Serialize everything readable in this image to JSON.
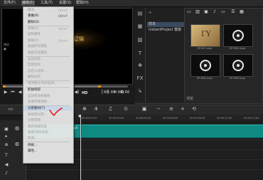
{
  "menubar": {
    "items": [
      "文件(F)",
      "编辑(E)",
      "工具(T)",
      "设置(S)",
      "帮助(H)"
    ]
  },
  "dropdown": {
    "items": [
      {
        "label": "撤消",
        "shortcut": "Ctrl+Z",
        "enabled": false
      },
      {
        "label": "重做(R)",
        "shortcut": "Ctrl+Y",
        "enabled": true
      },
      {
        "label": "删除(D)",
        "shortcut": "",
        "enabled": true
      },
      {
        "label": "复制(C)",
        "shortcut": "Ctrl+C",
        "enabled": false
      },
      {
        "label": "复制属性",
        "shortcut": "",
        "enabled": false
      },
      {
        "label": "粘贴(P)",
        "shortcut": "Ctrl+V",
        "enabled": false
      },
      {
        "label": "粘贴所有属性",
        "shortcut": "",
        "enabled": false
      },
      {
        "label": "粘贴可选属性...",
        "shortcut": "",
        "enabled": false
      },
      {
        "label": "运动追踪...",
        "shortcut": "",
        "enabled": false
      },
      {
        "label": "匹配动作",
        "shortcut": "",
        "enabled": false
      },
      {
        "label": "自定义动作...",
        "shortcut": "",
        "enabled": false
      },
      {
        "label": "删除动作",
        "shortcut": "",
        "enabled": false
      },
      {
        "label": "更改照片/色彩区间...",
        "shortcut": "",
        "enabled": false
      },
      {
        "label": "抓拍快照",
        "shortcut": "",
        "enabled": true
      },
      {
        "label": "自动摇动和缩放",
        "shortcut": "",
        "enabled": false
      },
      {
        "label": "多重修整视频...",
        "shortcut": "",
        "enabled": false
      },
      {
        "label": "分割素材(T)",
        "shortcut": "",
        "enabled": true
      },
      {
        "label": "按场景分割...",
        "shortcut": "",
        "enabled": false
      },
      {
        "label": "分割音频",
        "shortcut": "",
        "enabled": false
      },
      {
        "label": "重新链接检查",
        "shortcut": "",
        "enabled": false
      },
      {
        "label": "速度/时间流逝...",
        "shortcut": "",
        "enabled": false
      },
      {
        "label": "变速...",
        "shortcut": "",
        "enabled": false
      },
      {
        "label": "停帧...",
        "shortcut": "",
        "enabled": true
      },
      {
        "label": "属性...",
        "shortcut": "",
        "enabled": true
      }
    ],
    "highlighted_index": 16
  },
  "preview": {
    "caption": "辽锦",
    "ghost_text": [
      "播放",
      "■"
    ],
    "timecode": "00:00:00:06",
    "hd_label": "HD",
    "progress": 0.76
  },
  "library": {
    "add_label": "+",
    "folders": [
      {
        "label": "样本",
        "selected": true
      },
      {
        "label": "InstantProject 模板",
        "selected": false
      }
    ],
    "thumbs": [
      {
        "label": "SP-V01.mp4"
      },
      {
        "label": "SP-M01.mpa"
      },
      {
        "label": "SP-M02.mpa"
      },
      {
        "label": "SP-M03.mpa"
      }
    ],
    "status": "浏览"
  },
  "timeline": {
    "ruler_ticks": [
      "00:00:00:00",
      "00:00:02:00",
      "00:00:04:00",
      "00:00:06:00",
      "00:00:08:00",
      "00:00:10:00",
      "00:00:12:00"
    ],
    "clip_label": "mp4"
  },
  "colors": {
    "accent_orange": "#e89020",
    "clip_teal": "#0f8a82",
    "selection_blue": "#3b4a5e",
    "annotation_red": "#e02020"
  }
}
